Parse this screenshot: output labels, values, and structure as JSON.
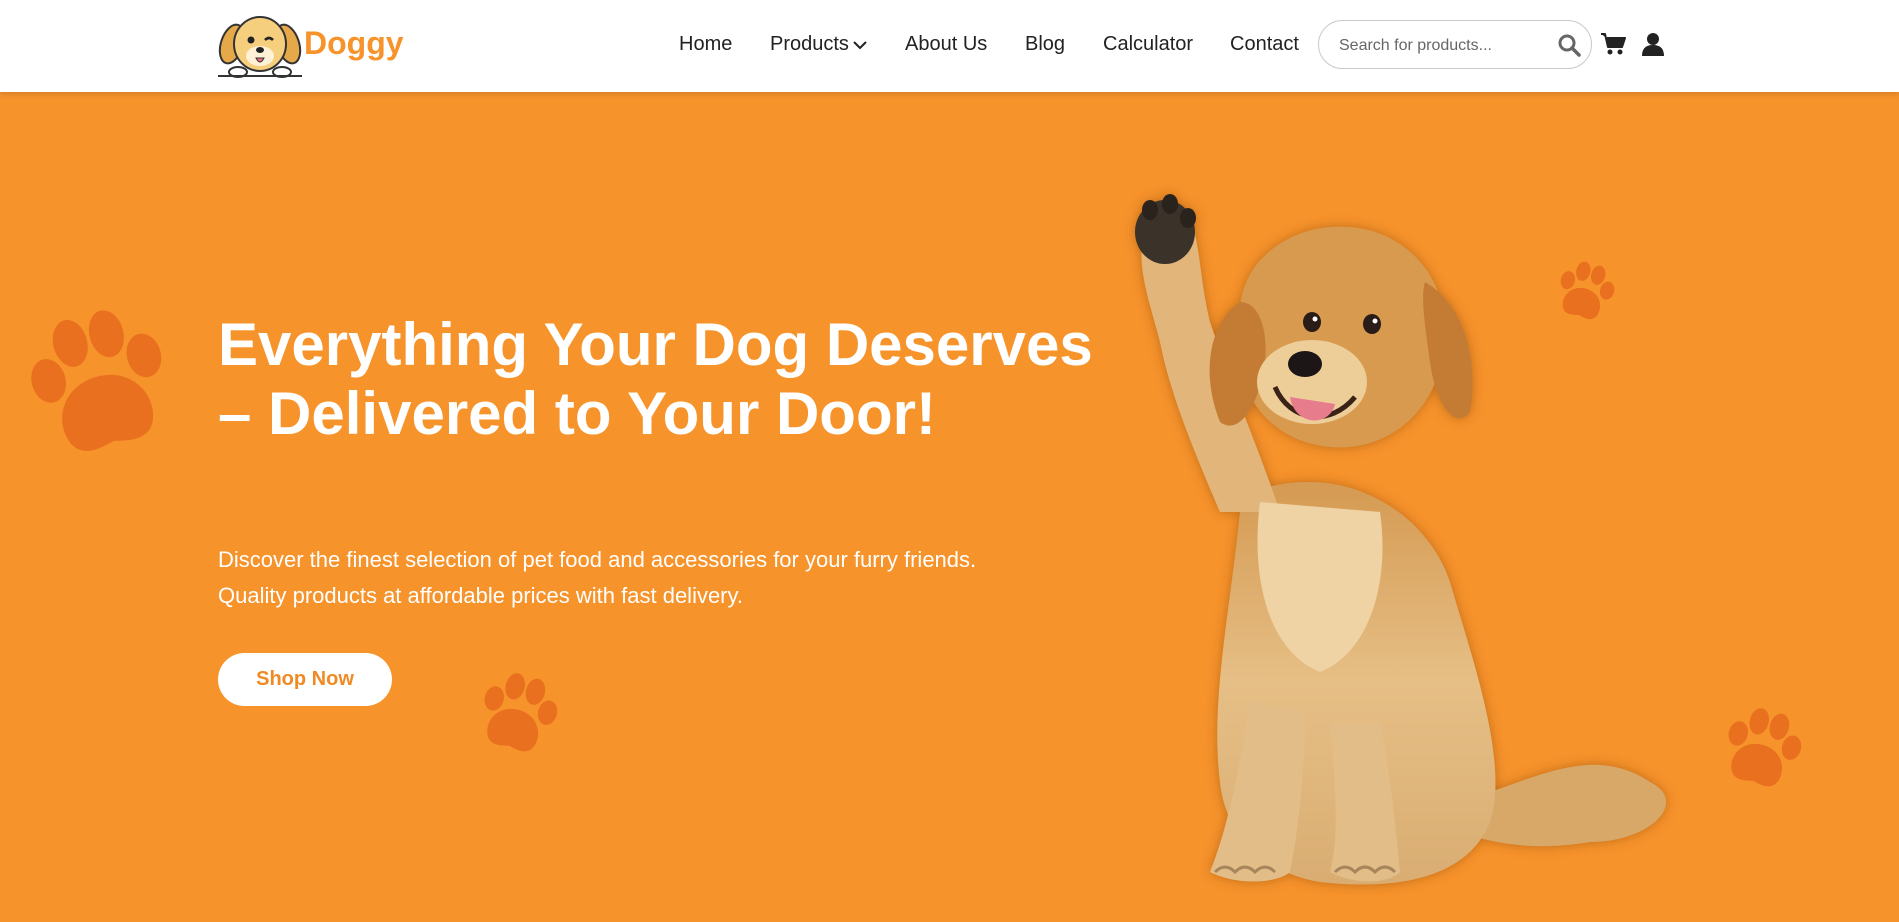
{
  "brand": {
    "name": "Doggy",
    "color": "#f7932b"
  },
  "nav": {
    "home": "Home",
    "products": "Products",
    "about": "About Us",
    "blog": "Blog",
    "calculator": "Calculator",
    "contact": "Contact"
  },
  "search": {
    "placeholder": "Search for products...",
    "value": ""
  },
  "icons": [
    "search-icon",
    "cart-icon",
    "user-icon",
    "chevron-down-icon"
  ],
  "hero": {
    "title": "Everything Your Dog Deserves – Delivered to Your Door!",
    "description": "Discover the finest selection of pet food and accessories for your furry friends. Quality products at affordable prices with fast delivery.",
    "cta": "Shop Now"
  },
  "colors": {
    "accent": "#f7932b",
    "paw": "#e8701f",
    "text": "#222222",
    "white": "#ffffff"
  }
}
